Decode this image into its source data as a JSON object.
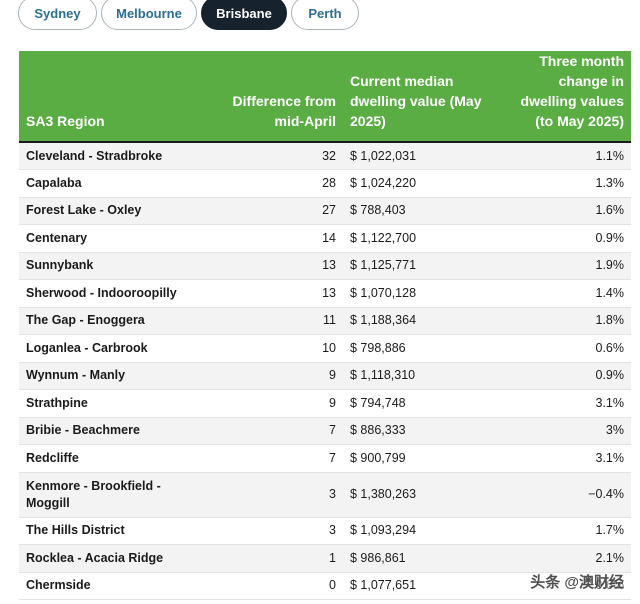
{
  "tabs": [
    {
      "label": "Sydney",
      "active": false
    },
    {
      "label": "Melbourne",
      "active": false
    },
    {
      "label": "Brisbane",
      "active": true
    },
    {
      "label": "Perth",
      "active": false
    }
  ],
  "table": {
    "headers": [
      "SA3 Region",
      "Difference from mid-April",
      "Current median dwelling value (May 2025)",
      "Three month change in dwelling values (to May 2025)"
    ],
    "rows": [
      [
        "Cleveland - Stradbroke",
        "32",
        "$ 1,022,031",
        "1.1%"
      ],
      [
        "Capalaba",
        "28",
        "$ 1,024,220",
        "1.3%"
      ],
      [
        "Forest Lake - Oxley",
        "27",
        "$ 788,403",
        "1.6%"
      ],
      [
        "Centenary",
        "14",
        "$ 1,122,700",
        "0.9%"
      ],
      [
        "Sunnybank",
        "13",
        "$ 1,125,771",
        "1.9%"
      ],
      [
        "Sherwood - Indooroopilly",
        "13",
        "$ 1,070,128",
        "1.4%"
      ],
      [
        "The Gap - Enoggera",
        "11",
        "$ 1,188,364",
        "1.8%"
      ],
      [
        "Loganlea - Carbrook",
        "10",
        "$ 798,886",
        "0.6%"
      ],
      [
        "Wynnum - Manly",
        "9",
        "$ 1,118,310",
        "0.9%"
      ],
      [
        "Strathpine",
        "9",
        "$ 794,748",
        "3.1%"
      ],
      [
        "Bribie - Beachmere",
        "7",
        "$ 886,333",
        "3%"
      ],
      [
        "Redcliffe",
        "7",
        "$ 900,799",
        "3.1%"
      ],
      [
        "Kenmore - Brookfield - Moggill",
        "3",
        "$ 1,380,263",
        "−0.4%"
      ],
      [
        "The Hills District",
        "3",
        "$ 1,093,294",
        "1.7%"
      ],
      [
        "Rocklea - Acacia Ridge",
        "1",
        "$ 986,861",
        "2.1%"
      ],
      [
        "Chermside",
        "0",
        "$ 1,077,651",
        "0.6%"
      ]
    ]
  },
  "watermark": "头条 @澳财经",
  "colors": {
    "header_green": "#5aad43",
    "active_tab": "#17222f",
    "tab_text": "#2d6f90"
  }
}
